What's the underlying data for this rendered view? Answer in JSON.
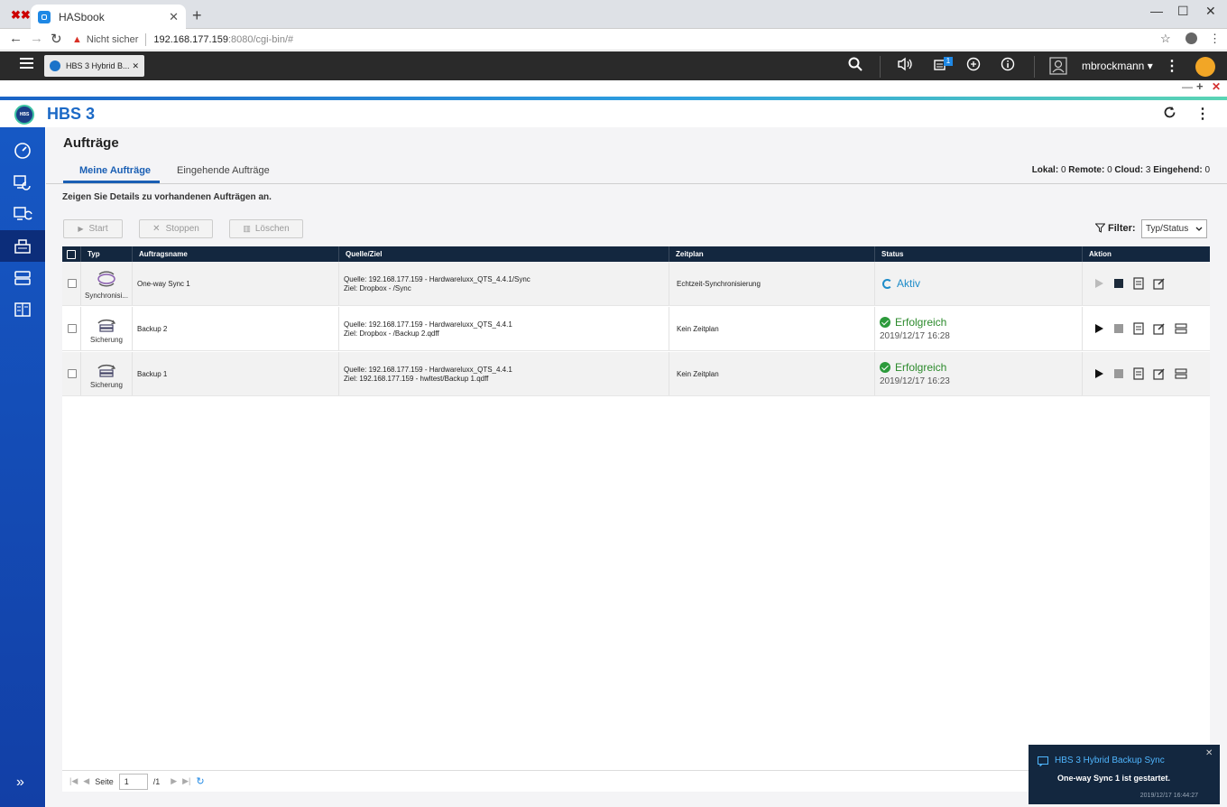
{
  "browser": {
    "tab_title": "HASbook",
    "tab_close": "✕",
    "new_tab": "+",
    "security_label": "Nicht sicher",
    "url_host": "192.168.177.159",
    "url_rest": ":8080/cgi-bin/#"
  },
  "qts": {
    "app_tab_title": "HBS 3 Hybrid B...",
    "app_tab_close": "✕",
    "notification_count": "1",
    "username": "mbrockmann ▾"
  },
  "app": {
    "logo_text": "HBS",
    "title": "HBS 3"
  },
  "page": {
    "title": "Aufträge",
    "tabs": [
      {
        "label": "Meine Aufträge",
        "active": true
      },
      {
        "label": "Eingehende Aufträge",
        "active": false
      }
    ],
    "counts": {
      "lokal_label": "Lokal:",
      "lokal": "0",
      "remote_label": "Remote:",
      "remote": "0",
      "cloud_label": "Cloud:",
      "cloud": "3",
      "eingehend_label": "Eingehend:",
      "eingehend": "0"
    },
    "description": "Zeigen Sie Details zu vorhandenen Aufträgen an.",
    "toolbar": {
      "start": "Start",
      "stop": "Stoppen",
      "delete": "Löschen",
      "filter_label": "Filter:",
      "filter_value": "Typ/Status"
    }
  },
  "table": {
    "columns": [
      "Typ",
      "Auftragsname",
      "Quelle/Ziel",
      "Zeitplan",
      "Status",
      "Aktion"
    ],
    "rows": [
      {
        "type": "Synchronisi...",
        "name": "One-way Sync 1",
        "source": "Quelle: 192.168.177.159 - Hardwareluxx_QTS_4.4.1/Sync",
        "target": "Ziel: Dropbox - /Sync",
        "schedule": "Echtzeit-Synchronisierung",
        "status": "Aktiv",
        "status_time": ""
      },
      {
        "type": "Sicherung",
        "name": "Backup 2",
        "source": "Quelle: 192.168.177.159 - Hardwareluxx_QTS_4.4.1",
        "target": "Ziel: Dropbox - /Backup 2.qdff",
        "schedule": "Kein Zeitplan",
        "status": "Erfolgreich",
        "status_time": "2019/12/17 16:28"
      },
      {
        "type": "Sicherung",
        "name": "Backup 1",
        "source": "Quelle: 192.168.177.159 - Hardwareluxx_QTS_4.4.1",
        "target": "Ziel: 192.168.177.159 - hwltest/Backup 1.qdff",
        "schedule": "Kein Zeitplan",
        "status": "Erfolgreich",
        "status_time": "2019/12/17 16:23"
      }
    ]
  },
  "pager": {
    "page_label": "Seite",
    "page_value": "1",
    "page_total": "/1"
  },
  "toast": {
    "title": "HBS 3 Hybrid Backup Sync",
    "message": "One-way Sync 1 ist gestartet.",
    "time": "2019/12/17 16:44:27",
    "close": "✕"
  },
  "colors": {
    "accent": "#1a5fb4",
    "sidebar": "#1658c4",
    "table_header": "#13273f",
    "success": "#2c8a2c",
    "active": "#1e8cc9"
  },
  "icons": {
    "sidebar": [
      "dashboard-icon",
      "backup-restore-icon",
      "sync-icon",
      "jobs-icon",
      "storage-icon",
      "services-icon"
    ],
    "row_actions": [
      "play-icon",
      "stop-icon",
      "log-icon",
      "edit-icon",
      "restore-icon"
    ]
  }
}
